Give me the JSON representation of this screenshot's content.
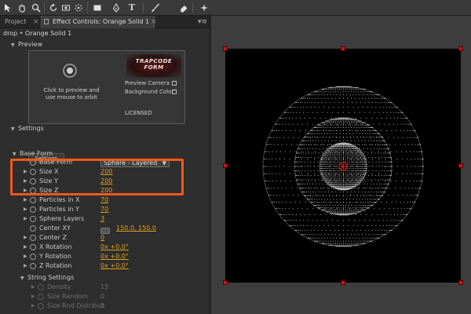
{
  "toolbar": {
    "tools": [
      "selection-tool",
      "hand-tool",
      "zoom-tool",
      "rotate-tool",
      "camera-orbit-tool",
      "pan-behind-tool",
      "rectangle-tool",
      "pen-tool",
      "type-tool",
      "brush-tool",
      "eraser-tool",
      "puppet-tool"
    ],
    "type_glyph": "T"
  },
  "panel": {
    "tabs": [
      {
        "label": "Project"
      },
      {
        "label": "Effect Controls: Orange Solid 1"
      }
    ],
    "close_glyph": "×",
    "menu_glyph": "▾≡",
    "breadcrumb": "drop • Orange Solid 1"
  },
  "preview": {
    "section_label": "Preview",
    "orbit_text": "Click to preview and use mouse to orbit",
    "logo_text": "TRAPCODE FORM",
    "preview_camera_label": "Preview Camera",
    "background_color_label": "Background Color",
    "licensed_label": "LICENSED"
  },
  "settings": {
    "section_label": "Settings",
    "button_label": "Settings"
  },
  "base_form": {
    "label": "Base Form",
    "base_form_label": "Base Form",
    "base_form_value": "Sphere - Layered",
    "properties": [
      {
        "label": "Size X",
        "value": "200"
      },
      {
        "label": "Size Y",
        "value": "200"
      },
      {
        "label": "Size Z",
        "value": "200"
      },
      {
        "label": "Particles in X",
        "value": "70"
      },
      {
        "label": "Particles in Y",
        "value": "70"
      },
      {
        "label": "Sphere Layers",
        "value": "3"
      },
      {
        "label": "Center XY",
        "value": "150.0, 150.0"
      },
      {
        "label": "Center Z",
        "value": "0"
      },
      {
        "label": "X Rotation",
        "value": "0x +0.0°"
      },
      {
        "label": "Y Rotation",
        "value": "0x +0.0°"
      },
      {
        "label": "Z Rotation",
        "value": "0x +0.0°"
      }
    ]
  },
  "string_settings": {
    "label": "String Settings",
    "properties": [
      {
        "label": "Density",
        "value": "15"
      },
      {
        "label": "Size Random",
        "value": "0"
      },
      {
        "label": "Size Rnd Distribut.",
        "value": "3"
      }
    ]
  },
  "viewer": {
    "background": "#000000",
    "particle_color": "#e8e8e8",
    "handle_color": "#c81818",
    "highlight_color": "#f05a1a"
  }
}
